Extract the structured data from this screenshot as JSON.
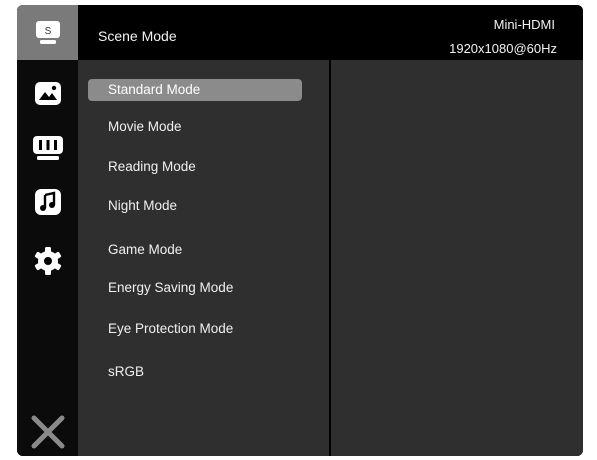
{
  "sidebar": {
    "items": [
      {
        "icon": "scene-mode-icon",
        "glyph": "S",
        "active": true
      },
      {
        "icon": "picture-icon"
      },
      {
        "icon": "display-icon"
      },
      {
        "icon": "audio-icon"
      },
      {
        "icon": "settings-gear-icon"
      }
    ],
    "exit_icon": "close-icon"
  },
  "header": {
    "title": "Scene Mode",
    "source": "Mini-HDMI",
    "resolution": "1920x1080@60Hz"
  },
  "menu": {
    "selected_index": 0,
    "items": [
      "Standard Mode",
      "Movie Mode",
      "Reading Mode",
      "Night Mode",
      "Game Mode",
      "Energy Saving Mode",
      "Eye Protection Mode",
      "sRGB"
    ]
  },
  "colors": {
    "background": "#000000",
    "panel": "#2f2f2f",
    "selected": "#8b8b8b",
    "text": "#f0f0f0"
  }
}
